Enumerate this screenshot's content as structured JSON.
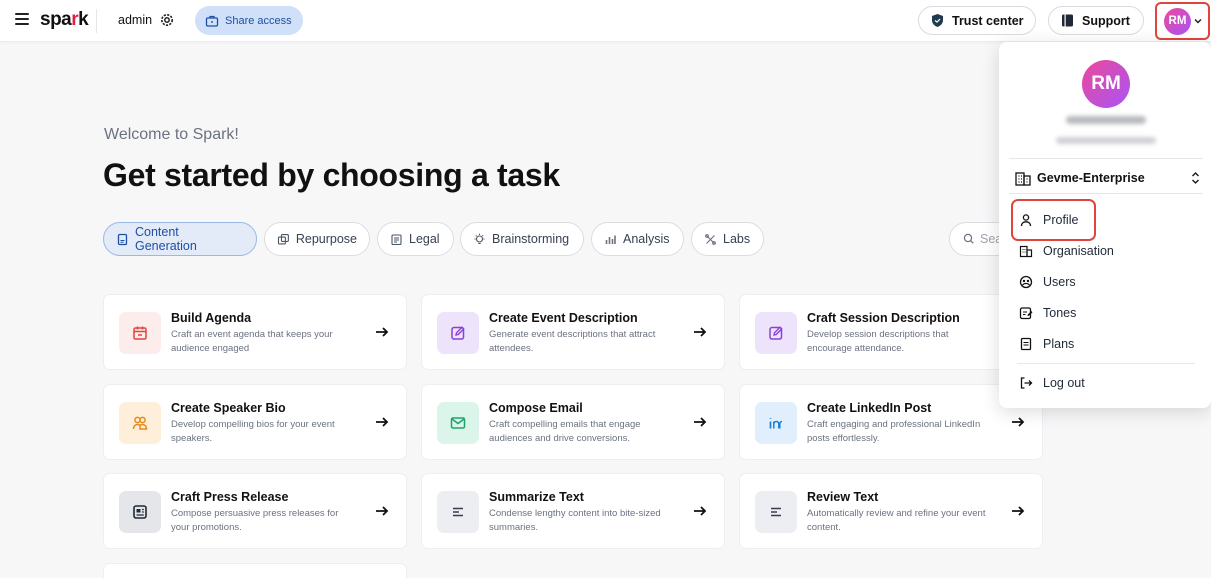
{
  "topbar": {
    "logo_pre": "spa",
    "logo_dot": "r",
    "logo_post": "k",
    "workspace": "admin",
    "share_label": "Share access",
    "trust_label": "Trust center",
    "support_label": "Support",
    "avatar_initials": "RM"
  },
  "main": {
    "welcome": "Welcome to Spark!",
    "headline": "Get started by choosing a task",
    "tabs": [
      {
        "label": "Content Generation",
        "icon": "document-icon",
        "active": true
      },
      {
        "label": "Repurpose",
        "icon": "repurpose-icon",
        "active": false
      },
      {
        "label": "Legal",
        "icon": "legal-icon",
        "active": false
      },
      {
        "label": "Brainstorming",
        "icon": "lightbulb-icon",
        "active": false
      },
      {
        "label": "Analysis",
        "icon": "bar-chart-icon",
        "active": false
      },
      {
        "label": "Labs",
        "icon": "labs-icon",
        "active": false
      }
    ],
    "search_placeholder": "Sea"
  },
  "cards": [
    {
      "title": "Build Agenda",
      "desc": "Craft an event agenda that keeps your audience engaged",
      "icon": "calendar-icon",
      "color": "#e0453b"
    },
    {
      "title": "Create Event Description",
      "desc": "Generate event descriptions that attract attendees.",
      "icon": "edit-icon",
      "color": "#8b3fd9"
    },
    {
      "title": "Craft Session Description",
      "desc": "Develop session descriptions that encourage attendance.",
      "icon": "edit-icon",
      "color": "#8b3fd9"
    },
    {
      "title": "Create Speaker Bio",
      "desc": "Develop compelling bios for your event speakers.",
      "icon": "people-icon",
      "color": "#e88a1a"
    },
    {
      "title": "Compose Email",
      "desc": "Craft compelling emails that engage audiences and drive conversions.",
      "icon": "mail-icon",
      "color": "#1fa36a"
    },
    {
      "title": "Create LinkedIn Post",
      "desc": "Craft engaging and professional LinkedIn posts effortlessly.",
      "icon": "linkedin-icon",
      "color": "#1e7fd0"
    },
    {
      "title": "Craft Press Release",
      "desc": "Compose persuasive press releases for your promotions.",
      "icon": "newspaper-icon",
      "color": "#374151"
    },
    {
      "title": "Summarize Text",
      "desc": "Condense lengthy content into bite-sized summaries.",
      "icon": "text-lines-icon",
      "color": "#374151"
    },
    {
      "title": "Review Text",
      "desc": "Automatically review and refine your event content.",
      "icon": "text-lines-icon",
      "color": "#374151"
    }
  ],
  "menu": {
    "avatar_initials": "RM",
    "org_name": "Gevme-Enterprise",
    "items": [
      {
        "label": "Profile",
        "icon": "user-icon"
      },
      {
        "label": "Organisation",
        "icon": "building-icon"
      },
      {
        "label": "Users",
        "icon": "users-globe-icon"
      },
      {
        "label": "Tones",
        "icon": "tones-icon"
      },
      {
        "label": "Plans",
        "icon": "plans-icon"
      },
      {
        "label": "Log out",
        "icon": "logout-icon"
      }
    ]
  }
}
